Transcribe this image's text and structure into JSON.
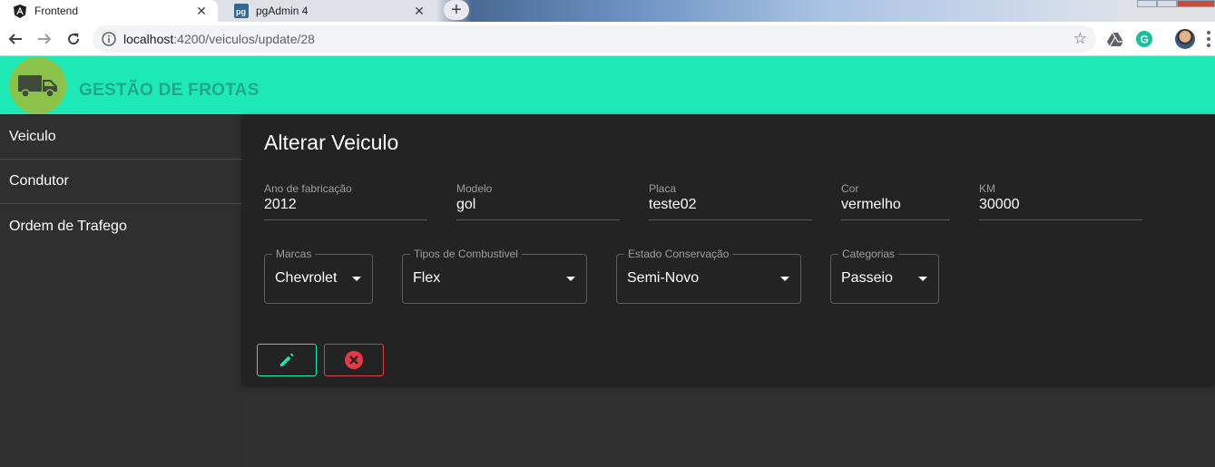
{
  "browser": {
    "tabs": [
      {
        "title": "Frontend",
        "icon": "angular-icon",
        "active": true
      },
      {
        "title": "pgAdmin 4",
        "icon": "pgadmin-icon",
        "active": false
      }
    ],
    "url_host": "localhost",
    "url_path": ":4200/veiculos/update/28"
  },
  "header": {
    "brand": "GESTÃO DE FROTAS",
    "color": "#1de9b6"
  },
  "sidebar": {
    "items": [
      {
        "label": "Veiculo"
      },
      {
        "label": "Condutor"
      },
      {
        "label": "Ordem de Trafego"
      }
    ]
  },
  "form": {
    "title": "Alterar Veiculo",
    "fields": [
      {
        "label": "Ano de fabricação",
        "value": "2012"
      },
      {
        "label": "Modelo",
        "value": "gol"
      },
      {
        "label": "Placa",
        "value": "teste02"
      },
      {
        "label": "Cor",
        "value": "vermelho"
      },
      {
        "label": "KM",
        "value": "30000"
      }
    ],
    "selects": [
      {
        "label": "Marcas",
        "value": "Chevrolet"
      },
      {
        "label": "Tipos de Combustivel",
        "value": "Flex"
      },
      {
        "label": "Estado Conservação",
        "value": "Semi-Novo"
      },
      {
        "label": "Categorias",
        "value": "Passeio"
      }
    ],
    "actions": {
      "edit_icon": "pencil-icon",
      "edit_color": "#1de9b6",
      "cancel_icon": "cancel-circle-icon",
      "cancel_color": "#e53945"
    }
  }
}
